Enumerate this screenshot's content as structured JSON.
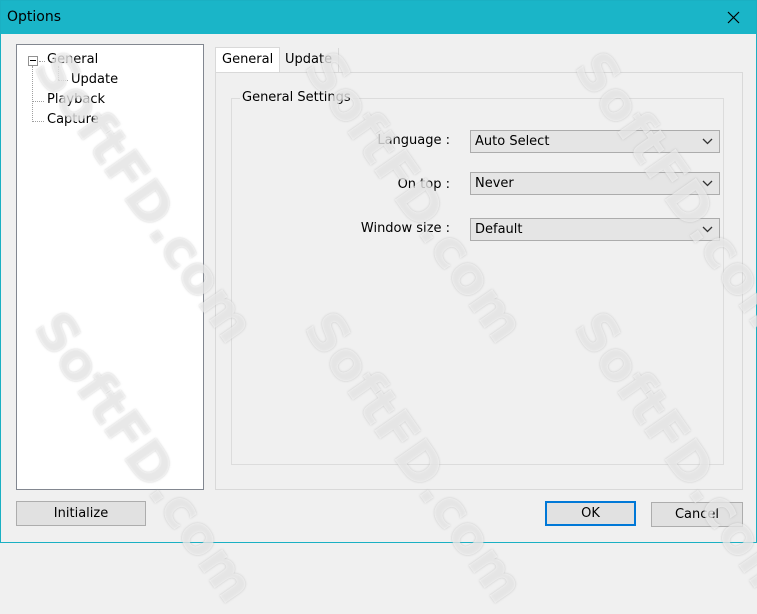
{
  "window": {
    "title": "Options"
  },
  "tree": {
    "items": [
      {
        "label": "General"
      },
      {
        "label": "Update"
      },
      {
        "label": "Playback"
      },
      {
        "label": "Capture"
      }
    ]
  },
  "tabs": [
    {
      "label": "General",
      "active": true
    },
    {
      "label": "Update",
      "active": false
    }
  ],
  "group": {
    "title": "General Settings",
    "fields": [
      {
        "label": "Language :",
        "value": "Auto Select"
      },
      {
        "label": "On top :",
        "value": "Never"
      },
      {
        "label": "Window size :",
        "value": "Default"
      }
    ]
  },
  "buttons": {
    "initialize": "Initialize",
    "ok": "OK",
    "cancel": "Cancel"
  },
  "watermark": "SoftFD.com",
  "colors": {
    "titlebar": "#1ab5c8",
    "default_button_border": "#0078d7"
  }
}
